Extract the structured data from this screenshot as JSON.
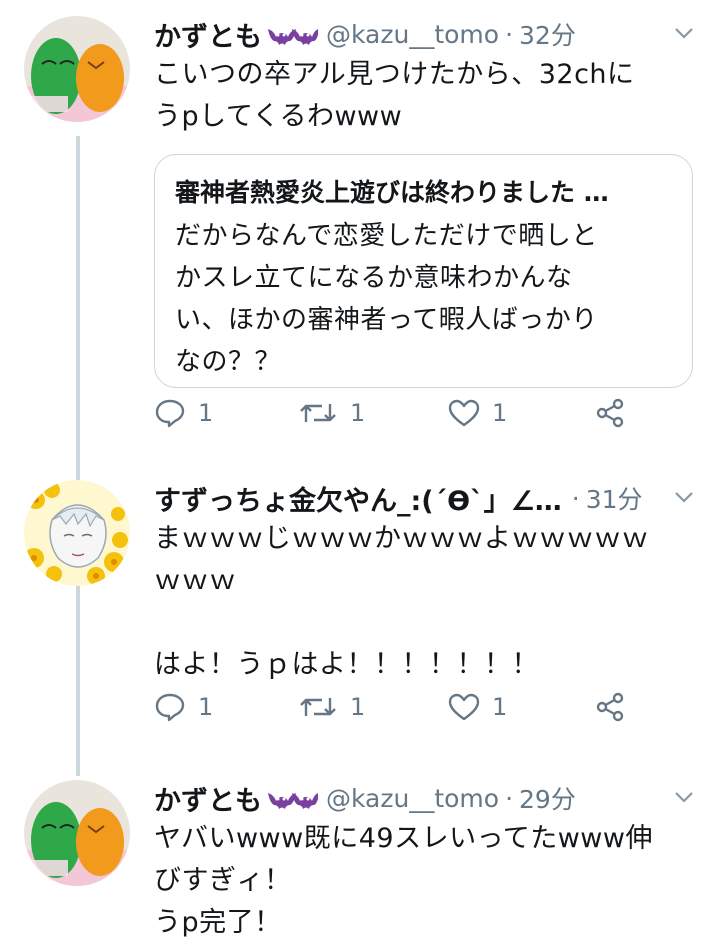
{
  "tweets": [
    {
      "name": "かずとも",
      "handle": "@kazu__tomo",
      "dot": "·",
      "time": "32分",
      "text_lines": [
        "こいつの卒アル見つけたから、32chに",
        "うpしてくるわwww"
      ],
      "quote": {
        "title": "審神者熱愛炎上遊びは終わりました …",
        "lines": [
          "だからなんで恋愛しただけで晒しと",
          "かスレ立てになるか意味わかんな",
          "い、ほかの審神者って暇人ばっかり",
          "なの？？"
        ]
      },
      "replies": "1",
      "retweets": "1",
      "likes": "1"
    },
    {
      "name": "すずっちょ金欠やん_:(´ϴ`」∠…",
      "handle": "",
      "dot": "",
      "time": "31分",
      "text_lines": [
        "まｗｗｗじｗｗｗかｗｗｗよｗｗｗｗｗ",
        "ｗｗｗ",
        "",
        "はよ！うｐはよ！！！！！！！"
      ],
      "replies": "1",
      "retweets": "1",
      "likes": "1"
    },
    {
      "name": "かずとも",
      "handle": "@kazu__tomo",
      "dot": "·",
      "time": "29分",
      "text_lines": [
        "ヤバいwww既に49スレいってたwww伸",
        "びすぎィ！",
        "うp完了！"
      ]
    }
  ],
  "colors": {
    "line": "#ccd6dd",
    "muted": "#657786",
    "bat": "#7b3fa0"
  },
  "icons": [
    "reply-icon",
    "retweet-icon",
    "like-icon",
    "share-icon",
    "chevron-down-icon",
    "bat-icon"
  ]
}
